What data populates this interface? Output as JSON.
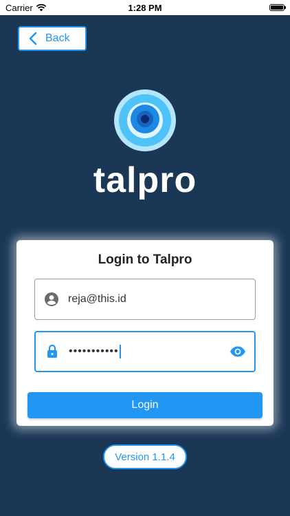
{
  "status_bar": {
    "carrier": "Carrier",
    "time": "1:28 PM",
    "icons": [
      "wifi-icon",
      "battery-icon"
    ]
  },
  "header": {
    "back_label": "Back",
    "back_icon": "chevron-left-icon"
  },
  "brand": {
    "name": "talpro",
    "logo_colors": [
      "#b3e5fc",
      "#4fc3f7",
      "#1e88e5",
      "#0d47a1"
    ]
  },
  "login_card": {
    "title": "Login to Talpro",
    "email": {
      "value": "reja@this.id",
      "icon": "account-circle-icon"
    },
    "password": {
      "value": "•••••••••••",
      "icon": "lock-icon",
      "toggle_icon": "eye-icon"
    },
    "submit_label": "Login"
  },
  "footer": {
    "version": "Version 1.1.4"
  },
  "colors": {
    "background": "#1b3756",
    "accent": "#2196f3",
    "card": "#ffffff"
  }
}
